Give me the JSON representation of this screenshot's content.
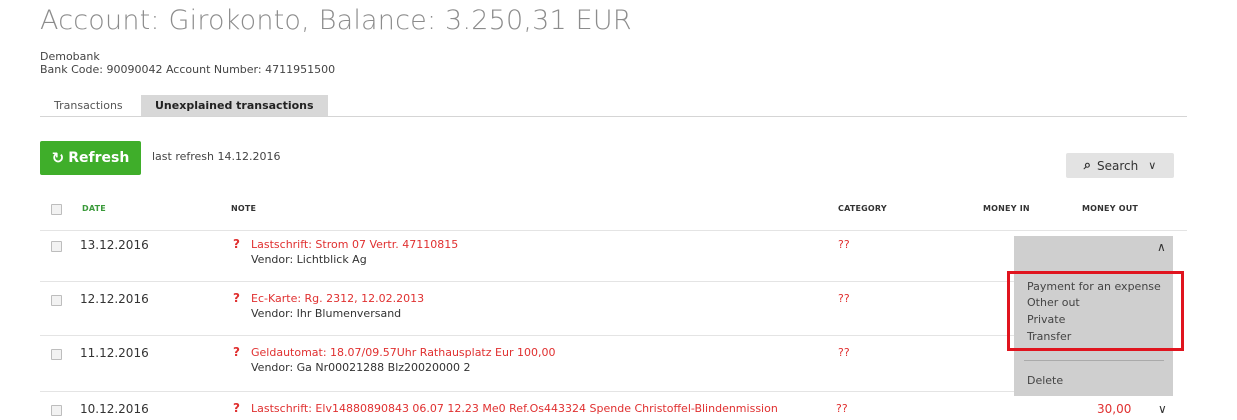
{
  "header": {
    "title": "Account: Girokonto, Balance: 3.250,31 EUR",
    "bank_name": "Demobank",
    "bank_details": "Bank Code: 90090042 Account Number: 4711951500"
  },
  "tabs": [
    {
      "label": "Transactions",
      "active": false
    },
    {
      "label": "Unexplained transactions",
      "active": true
    }
  ],
  "toolbar": {
    "refresh_label": "Refresh",
    "last_refresh": "last refresh 14.12.2016",
    "search_label": "Search",
    "refresh_color": "#3fae2a"
  },
  "table": {
    "columns": {
      "date": "DATE",
      "note": "NOTE",
      "category": "CATEGORY",
      "money_in": "MONEY IN",
      "money_out": "MONEY OUT"
    },
    "rows": [
      {
        "date": "13.12.2016",
        "note": "Lastschrift: Strom 07 Vertr. 47110815",
        "vendor": "Vendor: Lichtblick Ag",
        "category": "??",
        "money_out": ""
      },
      {
        "date": "12.12.2016",
        "note": "Ec-Karte: Rg. 2312, 12.02.2013",
        "vendor": "Vendor: Ihr Blumenversand",
        "category": "??",
        "money_out": ""
      },
      {
        "date": "11.12.2016",
        "note": "Geldautomat: 18.07/09.57Uhr Rathausplatz Eur 100,00",
        "vendor": "Vendor: Ga Nr00021288 Blz20020000 2",
        "category": "??",
        "money_out": ""
      },
      {
        "date": "10.12.2016",
        "note": "Lastschrift: Elv14880890843 06.07 12.23 Me0 Ref.Os443324 Spende Christoffel-Blindenmission",
        "vendor": "",
        "category": "??",
        "money_out": "30,00"
      }
    ]
  },
  "dropdown": {
    "options": [
      "Payment for an expense",
      "Other out",
      "Private",
      "Transfer"
    ],
    "delete_label": "Delete",
    "highlight_color": "#e0141e"
  },
  "icons": {
    "refresh": "refresh-icon",
    "search": "search-icon",
    "chevron_down": "chevron-down-icon",
    "chevron_up": "chevron-up-icon",
    "question": "question-mark-icon"
  }
}
